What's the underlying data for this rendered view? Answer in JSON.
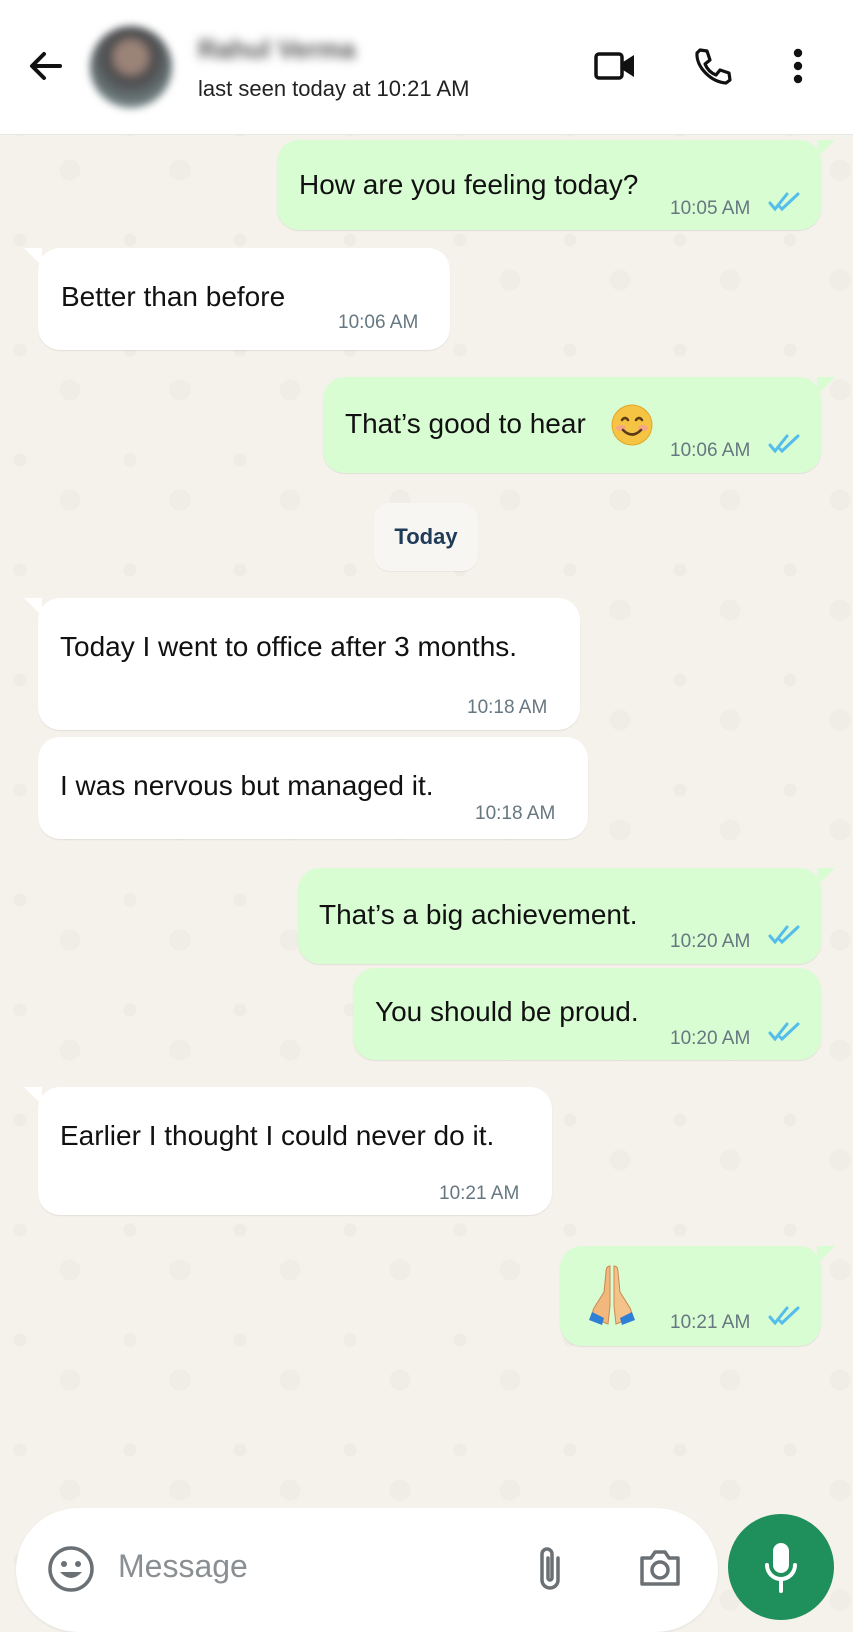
{
  "header": {
    "contact_name": "Rahul Verma",
    "status": "last seen today at 10:21 AM"
  },
  "messages": [
    {
      "dir": "out",
      "text": "How are you feeling today?",
      "time": "10:05 AM",
      "ticks": "double-blue-check-icon"
    },
    {
      "dir": "in",
      "text": "Better than before",
      "time": "10:06 AM"
    },
    {
      "dir": "out",
      "text": "That’s good to hear",
      "emoji": "smiling-face-icon",
      "time": "10:06 AM",
      "ticks": "double-blue-check-icon"
    },
    {
      "dir": "in",
      "text": "Today I went to office after 3 months.",
      "time": "10:18 AM"
    },
    {
      "dir": "in",
      "text": "I was nervous but managed it.",
      "time": "10:18 AM"
    },
    {
      "dir": "out",
      "text": "That’s a big achievement.",
      "time": "10:20 AM",
      "ticks": "double-blue-check-icon"
    },
    {
      "dir": "out",
      "text": "You should be proud.",
      "time": "10:20 AM",
      "ticks": "double-blue-check-icon"
    },
    {
      "dir": "in",
      "text": "Earlier I thought I could never do it.",
      "time": "10:21 AM"
    },
    {
      "dir": "out",
      "emoji": "folded-hands-icon",
      "time": "10:21 AM",
      "ticks": "double-blue-check-icon"
    }
  ],
  "date_separator": "Today",
  "composer": {
    "placeholder": "Message"
  },
  "colors": {
    "outgoing_bubble": "#d9fdd3",
    "incoming_bubble": "#ffffff",
    "read_tick": "#53bdeb",
    "mic_button": "#1f8f5b"
  }
}
